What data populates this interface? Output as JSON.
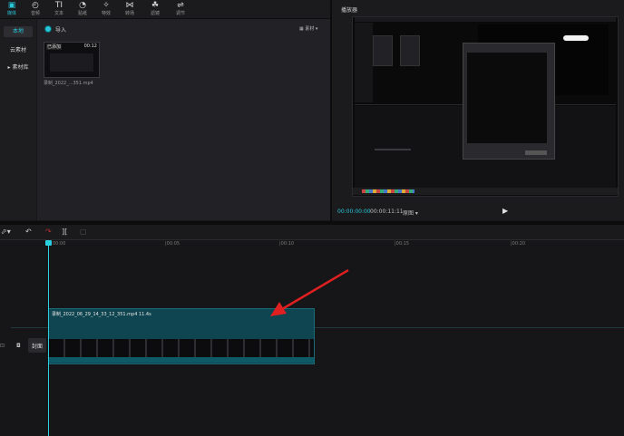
{
  "toolbar": {
    "tools": [
      {
        "label": "媒体",
        "icon": "media-icon"
      },
      {
        "label": "音频",
        "icon": "audio-icon"
      },
      {
        "label": "文本",
        "icon": "text-icon"
      },
      {
        "label": "贴纸",
        "icon": "sticker-icon"
      },
      {
        "label": "特效",
        "icon": "effects-icon"
      },
      {
        "label": "转场",
        "icon": "transition-icon"
      },
      {
        "label": "滤镜",
        "icon": "filter-icon"
      },
      {
        "label": "调节",
        "icon": "adjust-icon"
      }
    ]
  },
  "sidebar": {
    "items": [
      {
        "label": "本地"
      },
      {
        "label": "云素材"
      },
      {
        "label": "▸ 素材库"
      }
    ]
  },
  "media": {
    "import_label": "导入",
    "sort_label": "▦ 素材 ▾",
    "clip_name": "录制_2022_...351.mp4",
    "clip_duration": "00:12",
    "clip_badge": "已添加"
  },
  "player": {
    "title": "播放器",
    "current_time": "00:00:00:00",
    "total_time": "00:00:11:11",
    "quality": "原图 ▾"
  },
  "timeline": {
    "ruler_labels": [
      "00:00",
      "|00:05",
      "|00:10",
      "|00:15",
      "|00:20"
    ],
    "clip_label": "录制_2022_06_29_14_33_12_351.mp4   11.4s",
    "cover_label": "封面"
  },
  "colors": {
    "accent": "#27c5d8",
    "clip": "#0f4550",
    "arrow": "#e02020"
  }
}
